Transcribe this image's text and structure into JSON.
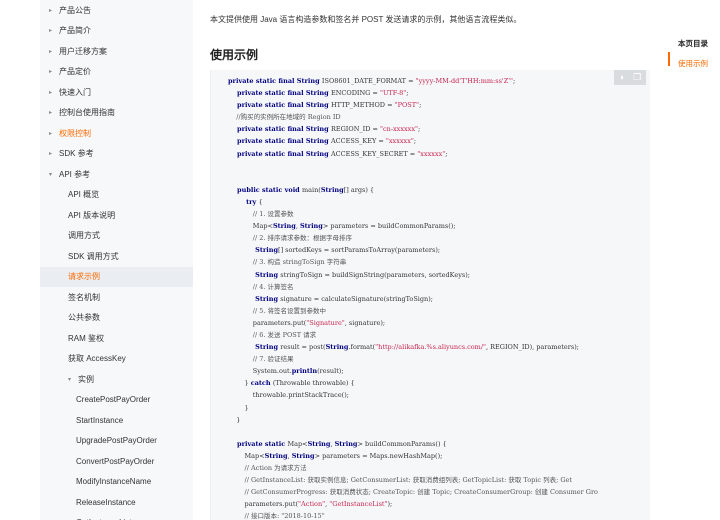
{
  "sidebar": {
    "items": [
      {
        "label": "产品公告",
        "level": 0,
        "caret": "▸",
        "state": "normal"
      },
      {
        "label": "产品简介",
        "level": 0,
        "caret": "▸",
        "state": "normal"
      },
      {
        "label": "用户迁移方案",
        "level": 0,
        "caret": "▸",
        "state": "normal"
      },
      {
        "label": "产品定价",
        "level": 0,
        "caret": "▸",
        "state": "normal"
      },
      {
        "label": "快速入门",
        "level": 0,
        "caret": "▸",
        "state": "normal"
      },
      {
        "label": "控制台使用指南",
        "level": 0,
        "caret": "▸",
        "state": "normal"
      },
      {
        "label": "权限控制",
        "level": 0,
        "caret": "▸",
        "state": "highlight"
      },
      {
        "label": "SDK 参考",
        "level": 0,
        "caret": "▸",
        "state": "normal"
      },
      {
        "label": "API 参考",
        "level": 0,
        "caret": "▾",
        "state": "normal"
      },
      {
        "label": "API 概览",
        "level": 1,
        "caret": "",
        "state": "normal"
      },
      {
        "label": "API 版本说明",
        "level": 1,
        "caret": "",
        "state": "normal"
      },
      {
        "label": "调用方式",
        "level": 1,
        "caret": "",
        "state": "normal"
      },
      {
        "label": "SDK 调用方式",
        "level": 1,
        "caret": "",
        "state": "normal"
      },
      {
        "label": "请求示例",
        "level": 1,
        "caret": "",
        "state": "active"
      },
      {
        "label": "签名机制",
        "level": 1,
        "caret": "",
        "state": "normal"
      },
      {
        "label": "公共参数",
        "level": 1,
        "caret": "",
        "state": "normal"
      },
      {
        "label": "RAM 鉴权",
        "level": 1,
        "caret": "",
        "state": "normal"
      },
      {
        "label": "获取 AccessKey",
        "level": 1,
        "caret": "",
        "state": "normal"
      },
      {
        "label": "实例",
        "level": 1,
        "caret": "▾",
        "state": "normal"
      },
      {
        "label": "CreatePostPayOrder",
        "level": 2,
        "caret": "",
        "state": "normal"
      },
      {
        "label": "StartInstance",
        "level": 2,
        "caret": "",
        "state": "normal"
      },
      {
        "label": "UpgradePostPayOrder",
        "level": 2,
        "caret": "",
        "state": "normal"
      },
      {
        "label": "ConvertPostPayOrder",
        "level": 2,
        "caret": "",
        "state": "normal"
      },
      {
        "label": "ModifyInstanceName",
        "level": 2,
        "caret": "",
        "state": "normal"
      },
      {
        "label": "ReleaseInstance",
        "level": 2,
        "caret": "",
        "state": "normal"
      },
      {
        "label": "GetInstanceList",
        "level": 2,
        "caret": "",
        "state": "normal"
      }
    ]
  },
  "main": {
    "intro": "本文提供使用 Java 语言构造参数和签名并 POST 发送请求的示例，其他语言流程类似。",
    "section_title": "使用示例",
    "code_tools": {
      "toggle_icon": "◑",
      "copy_icon": "❐"
    },
    "code_lines": [
      [
        [
          "k",
          "private static final String "
        ],
        [
          "t",
          "ISO8601_DATE_FORMAT = "
        ],
        [
          "s",
          "\"yyyy-MM-dd'T'HH:mm:ss'Z'\""
        ],
        [
          "t",
          ";"
        ]
      ],
      [
        [
          "k",
          "    private static final String "
        ],
        [
          "t",
          "ENCODING = "
        ],
        [
          "s",
          "\"UTF-8\""
        ],
        [
          "t",
          ";"
        ]
      ],
      [
        [
          "k",
          "    private static final String "
        ],
        [
          "t",
          "HTTP_METHOD = "
        ],
        [
          "s",
          "\"POST\""
        ],
        [
          "t",
          ";"
        ]
      ],
      [
        [
          "c",
          "    //购买的实例所在地域的 Region ID"
        ]
      ],
      [
        [
          "k",
          "    private static final String "
        ],
        [
          "t",
          "REGION_ID = "
        ],
        [
          "s",
          "\"cn-xxxxxx\""
        ],
        [
          "t",
          ";"
        ]
      ],
      [
        [
          "k",
          "    private static final String "
        ],
        [
          "t",
          "ACCESS_KEY = "
        ],
        [
          "s",
          "\"xxxxxx\""
        ],
        [
          "t",
          ";"
        ]
      ],
      [
        [
          "k",
          "    private static final String "
        ],
        [
          "t",
          "ACCESS_KEY_SECRET = "
        ],
        [
          "s",
          "\"xxxxxx\""
        ],
        [
          "t",
          ";"
        ]
      ],
      [
        [
          "t",
          ""
        ]
      ],
      [
        [
          "t",
          ""
        ]
      ],
      [
        [
          "k",
          "    public static void "
        ],
        [
          "t",
          "main("
        ],
        [
          "k",
          "String"
        ],
        [
          "t",
          "[] args) {"
        ]
      ],
      [
        [
          "k",
          "        try "
        ],
        [
          "t",
          "{"
        ]
      ],
      [
        [
          "c",
          "            // 1. 设置参数"
        ]
      ],
      [
        [
          "t",
          "            Map<"
        ],
        [
          "k",
          "String"
        ],
        [
          "t",
          ", "
        ],
        [
          "k",
          "String"
        ],
        [
          "t",
          "> parameters = buildCommonParams();"
        ]
      ],
      [
        [
          "c",
          "            // 2. 排序请求参数：根据字母排序"
        ]
      ],
      [
        [
          "k",
          "            String"
        ],
        [
          "t",
          "[] sortedKeys = sortParamsToArray(parameters);"
        ]
      ],
      [
        [
          "c",
          "            // 3. 构造 stringToSign 字符串"
        ]
      ],
      [
        [
          "k",
          "            String "
        ],
        [
          "t",
          "stringToSign = buildSignString(parameters, sortedKeys);"
        ]
      ],
      [
        [
          "c",
          "            // 4. 计算签名"
        ]
      ],
      [
        [
          "k",
          "            String "
        ],
        [
          "t",
          "signature = calculateSignature(stringToSign);"
        ]
      ],
      [
        [
          "c",
          "            // 5. 将签名设置到参数中"
        ]
      ],
      [
        [
          "t",
          "            parameters.put("
        ],
        [
          "s",
          "\"Signature\""
        ],
        [
          "t",
          ", signature);"
        ]
      ],
      [
        [
          "c",
          "            // 6. 发送 POST 请求"
        ]
      ],
      [
        [
          "k",
          "            String "
        ],
        [
          "t",
          "result = post("
        ],
        [
          "k",
          "String"
        ],
        [
          "t",
          ".format("
        ],
        [
          "s",
          "\"http://alikafka.%s.aliyuncs.com/\""
        ],
        [
          "t",
          ", REGION_ID), parameters);"
        ]
      ],
      [
        [
          "c",
          "            // 7. 验证结果"
        ]
      ],
      [
        [
          "t",
          "            System.out."
        ],
        [
          "k",
          "println"
        ],
        [
          "t",
          "(result);"
        ]
      ],
      [
        [
          "t",
          "        } "
        ],
        [
          "k",
          "catch "
        ],
        [
          "t",
          "(Throwable throwable) {"
        ]
      ],
      [
        [
          "t",
          "            throwable.printStackTrace();"
        ]
      ],
      [
        [
          "t",
          "        }"
        ]
      ],
      [
        [
          "t",
          "    }"
        ]
      ],
      [
        [
          "t",
          ""
        ]
      ],
      [
        [
          "k",
          "    private static "
        ],
        [
          "t",
          "Map<"
        ],
        [
          "k",
          "String"
        ],
        [
          "t",
          ", "
        ],
        [
          "k",
          "String"
        ],
        [
          "t",
          "> buildCommonParams() {"
        ]
      ],
      [
        [
          "t",
          "        Map<"
        ],
        [
          "k",
          "String"
        ],
        [
          "t",
          ", "
        ],
        [
          "k",
          "String"
        ],
        [
          "t",
          "> parameters = Maps.newHashMap();"
        ]
      ],
      [
        [
          "c",
          "        // Action 为请求方法"
        ]
      ],
      [
        [
          "c",
          "        // GetInstanceList: 获取实例信息; GetConsumerList: 获取消费组列表; GetTopicList: 获取 Topic 列表; Get"
        ]
      ],
      [
        [
          "c",
          "        // GetConsumerProgress: 获取消费状态; CreateTopic: 创建 Topic; CreateConsumerGroup: 创建 Consumer Gro"
        ]
      ],
      [
        [
          "t",
          "        parameters.put("
        ],
        [
          "s",
          "\"Action\""
        ],
        [
          "t",
          ", "
        ],
        [
          "s",
          "\"GetInstanceList\""
        ],
        [
          "t",
          ");"
        ]
      ],
      [
        [
          "c",
          "        // 接口版本: \"2018-10-15\""
        ]
      ]
    ]
  },
  "toc": {
    "title": "本页目录",
    "items": [
      "使用示例"
    ]
  },
  "colors": {
    "accent": "#ff6a00",
    "keyword": "#000080",
    "string": "#c7254e"
  }
}
